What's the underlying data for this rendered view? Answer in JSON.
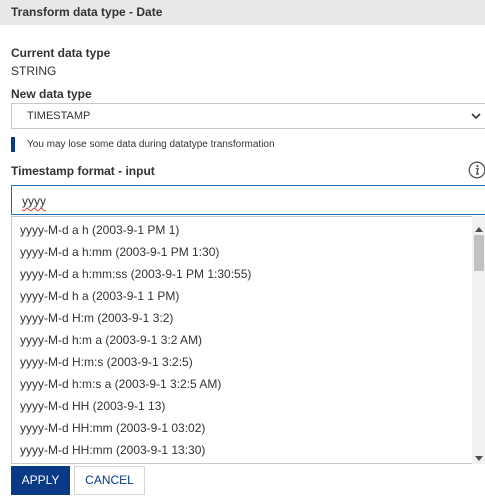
{
  "dialog": {
    "title": "Transform data type - Date"
  },
  "current_type": {
    "label": "Current data type",
    "value": "STRING"
  },
  "new_type": {
    "label": "New data type",
    "selected": "TIMESTAMP"
  },
  "warning": {
    "text": "You may lose some data during datatype transformation"
  },
  "timestamp_format": {
    "label": "Timestamp format - input",
    "value": "yyyy",
    "options": [
      "yyyy-M-d a h (2003-9-1 PM 1)",
      "yyyy-M-d a h:mm (2003-9-1 PM 1:30)",
      "yyyy-M-d a h:mm:ss (2003-9-1 PM 1:30:55)",
      "yyyy-M-d h a (2003-9-1 1 PM)",
      "yyyy-M-d H:m (2003-9-1 3:2)",
      "yyyy-M-d h:m a (2003-9-1 3:2 AM)",
      "yyyy-M-d H:m:s (2003-9-1 3:2:5)",
      "yyyy-M-d h:m:s a (2003-9-1 3:2:5 AM)",
      "yyyy-M-d HH (2003-9-1 13)",
      "yyyy-M-d HH:mm (2003-9-1 03:02)",
      "yyyy-M-d HH:mm (2003-9-1 13:30)"
    ]
  },
  "buttons": {
    "apply": "APPLY",
    "cancel": "CANCEL"
  },
  "colors": {
    "primary": "#0a3a86",
    "focus_border": "#2b6cb8",
    "title_bar": "#e8e8e8"
  },
  "icons": {
    "info": "info-icon",
    "dropdown": "chevron-down-icon"
  }
}
